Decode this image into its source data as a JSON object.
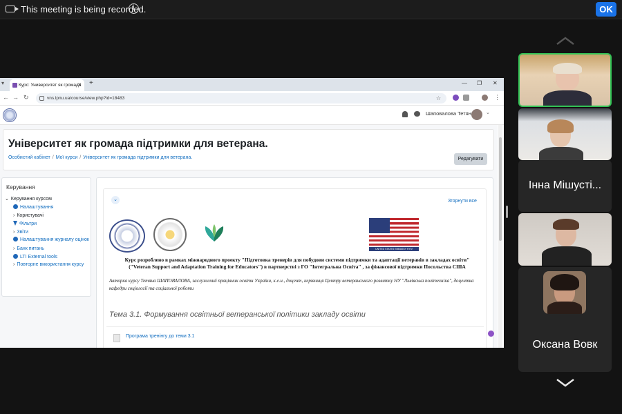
{
  "meeting": {
    "recording_text": "This meeting is being recorded.",
    "ok_label": "OK"
  },
  "browser": {
    "tab_title": "Курс: Университет як громада",
    "new_tab_label": "+",
    "url": "vns.lpnu.ua/course/view.php?id=18483"
  },
  "moodle": {
    "user_name": "Шаповалова Тетяна",
    "page_title": "Університет як громада підтримки для ветерана.",
    "breadcrumbs": [
      "Особистий кабінет",
      "Мої курси",
      "Університет як громада підтримки для ветерана."
    ],
    "edit_button": "Редагувати",
    "block": {
      "title": "Керування",
      "items": [
        {
          "label": "Керування курсом",
          "icon": "chevron-down-icon"
        },
        {
          "label": "Налаштування",
          "icon": "gear-icon"
        },
        {
          "label": "Користувачі",
          "icon": "chevron-right-icon"
        },
        {
          "label": "Фільтри",
          "icon": "filter-icon"
        },
        {
          "label": "Звіти",
          "icon": "chevron-right-icon"
        },
        {
          "label": "Налаштування журналу оцінок",
          "icon": "gear-icon"
        },
        {
          "label": "Банк питань",
          "icon": "chevron-right-icon"
        },
        {
          "label": "LTI External tools",
          "icon": "gear-icon"
        },
        {
          "label": "Повторне використання курсу",
          "icon": "chevron-right-icon"
        }
      ]
    },
    "section": {
      "collapse_all": "Згорнути все",
      "flag_caption": "UNITED STATES EMBASSY KYIV",
      "credits_line1": "Курс розроблено в рамках міжнародного проекту \"Підготовка тренерів для побудови системи підтримки та адаптації ветеранів в закладах освіти\"",
      "credits_line2": "(\"Veteran Support and Adaptation Training for Educators\") в партнерстві з ГО \"Інтегральна Освіта\" , за фінансової підтримки Посольства США",
      "author_text": "Авторка курсу Тетяна ШАПОВАЛОВА, заслужений працівник освіти України, к.е.н., доцент, керівниця Центру ветеранського розвитку НУ \"Львівська політехніка\", доцентка кафедри соціології та соціальної роботи",
      "topic_title": "Тема 3.1. Формування освітньої ветеранської  політики закладу освіти",
      "resource_link": "Програма тренінгу до теми 3.1"
    }
  },
  "participants": [
    {
      "name": "",
      "active": true
    },
    {
      "name": "",
      "active": false
    },
    {
      "name": "Інна Мішусті...",
      "active": false
    },
    {
      "name": "",
      "active": false
    },
    {
      "name": "Оксана Вовк",
      "active": false
    }
  ],
  "colors": {
    "accent": "#1a73e8",
    "active_speaker": "#32c255",
    "moodle_link": "#0f6cbf"
  }
}
